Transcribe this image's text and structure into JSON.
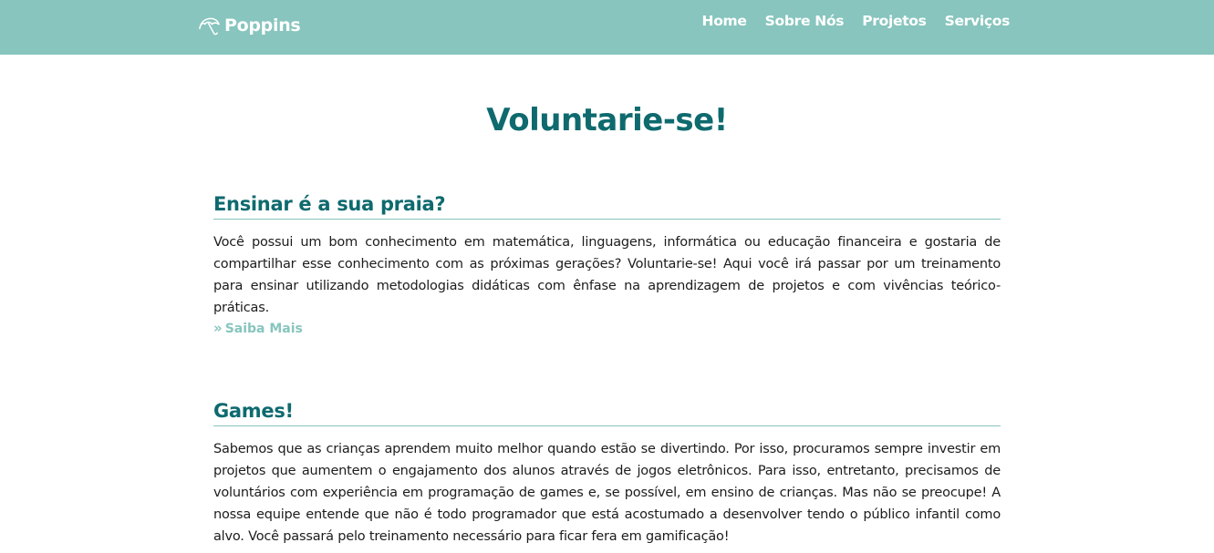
{
  "brand": {
    "name": "Poppins",
    "icon": "umbrella-icon"
  },
  "nav": [
    "Home",
    "Sobre Nós",
    "Projetos",
    "Serviços"
  ],
  "page_title": "Voluntarie-se!",
  "sections": [
    {
      "heading": "Ensinar é a sua praia?",
      "text": "Você possui um bom conhecimento em matemática, linguagens, informática ou educação financeira e gostaria de compartilhar esse conhecimento com as próximas gerações? Voluntarie-se! Aqui você irá passar por um treinamento para ensinar utilizando metodologias didáticas com ênfase na aprendizagem de projetos e com vivências teórico-práticas.",
      "link": "Saiba Mais"
    },
    {
      "heading": "Games!",
      "text": "Sabemos que as crianças aprendem muito melhor quando estão se divertindo. Por isso, procuramos sempre investir em projetos que aumentem o engajamento dos alunos através de jogos eletrônicos. Para isso, entretanto, precisamos de voluntários com experiência em programação de games e, se possível, em ensino de crianças. Mas não se preocupe! A nossa equipe entende que não é todo programador que está acostumado a desenvolver tendo o público infantil como alvo. Você passará pelo treinamento necessário para ficar fera em gamificação!"
    }
  ],
  "colors": {
    "navbar": "#87c5be",
    "heading": "#0e6a6e",
    "link": "#87c5be",
    "divider": "#87c5be"
  }
}
